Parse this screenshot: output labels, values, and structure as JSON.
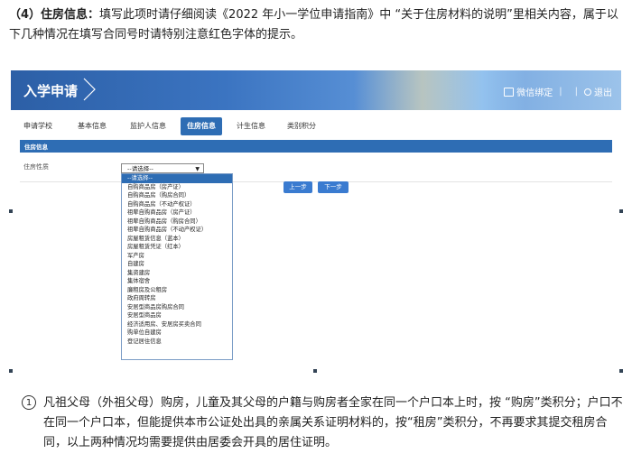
{
  "intro": {
    "lead": "（4）住房信息：",
    "text": "填写此项时请仔细阅读《2022 年小一学位申请指南》中 “关于住房材料的说明”里相关内容，属于以下几种情况在填写合同号时请特别注意红色字体的提示。"
  },
  "app": {
    "title": "入学申请",
    "wechat_bind": "微信绑定",
    "separators": [
      "|",
      "|"
    ],
    "logout": "退出",
    "icons": [
      "monitor-icon",
      "power-icon",
      "chevron-right-icon"
    ],
    "accent_color": "#2e6db4"
  },
  "tabs": [
    {
      "label": "申请学校",
      "active": false
    },
    {
      "label": "基本信息",
      "active": false
    },
    {
      "label": "监护人信息",
      "active": false
    },
    {
      "label": "住房信息",
      "active": true
    },
    {
      "label": "计生信息",
      "active": false
    },
    {
      "label": "类别积分",
      "active": false
    }
  ],
  "section": {
    "title": "住房信息",
    "field_label": "住房性质",
    "select_value": "--请选择--"
  },
  "buttons": {
    "prev": "上一步",
    "next": "下一步"
  },
  "dropdown_options": [
    "--请选择--",
    "自购商品房（房产证）",
    "自购商品房（购房合同）",
    "自购商品房（不动产权证）",
    "祖辈自购商品房（房产证）",
    "祖辈自购商品房（购房合同）",
    "祖辈自购商品房（不动产权证）",
    "房屋租赁信息（蓝本）",
    "房屋租赁凭证（红本）",
    "军产房",
    "自建房",
    "集资建房",
    "集体宿舍",
    "廉租房及公租房",
    "政府周转房",
    "安居型商品房购房合同",
    "安居型商品房",
    "经济适用房、安居房买卖合同",
    "购单位自建房",
    "登记居住信息"
  ],
  "note": {
    "number": "1",
    "text": "凡祖父母（外祖父母）购房，儿童及其父母的户籍与购房者全家在同一个户口本上时，按 “购房”类积分；户口不在同一个户口本，但能提供本市公证处出具的亲属关系证明材料的，按“租房”类积分，不再要求其提交租房合同，以上两种情况均需要提供由居委会开具的居住证明。"
  }
}
